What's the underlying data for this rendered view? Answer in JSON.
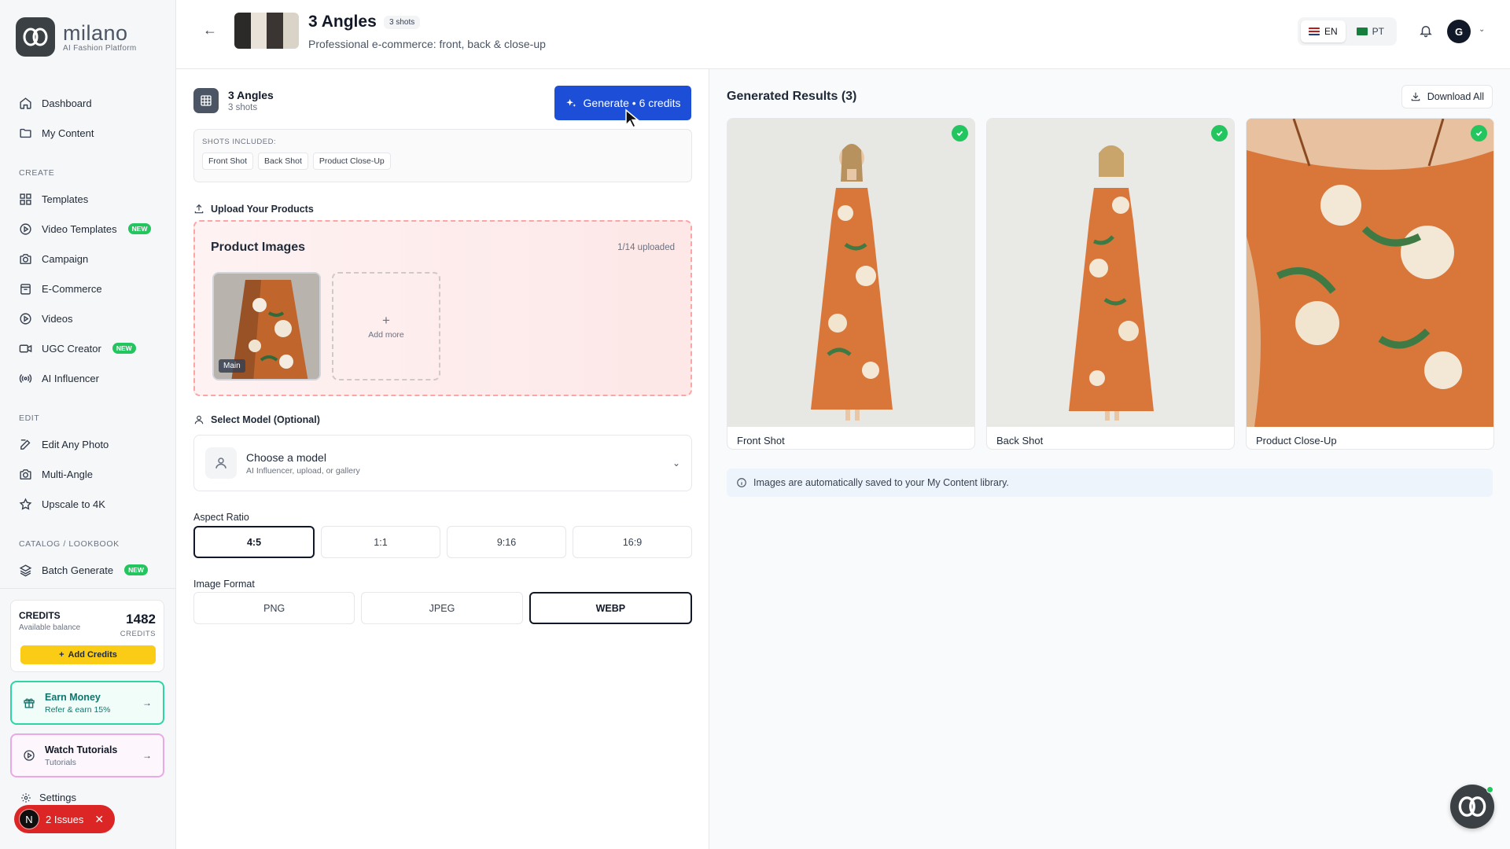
{
  "brand": {
    "name": "milano",
    "tagline": "AI Fashion Platform"
  },
  "nav": {
    "top": [
      {
        "label": "Dashboard",
        "icon": "home-icon"
      },
      {
        "label": "My Content",
        "icon": "folder-icon"
      }
    ],
    "create_label": "CREATE",
    "create": [
      {
        "label": "Templates",
        "icon": "grid-icon"
      },
      {
        "label": "Video Templates",
        "icon": "play-circle-icon",
        "badge": "NEW"
      },
      {
        "label": "Campaign",
        "icon": "camera-icon"
      },
      {
        "label": "E-Commerce",
        "icon": "shopping-bag-icon"
      },
      {
        "label": "Videos",
        "icon": "play-circle-icon"
      },
      {
        "label": "UGC Creator",
        "icon": "video-icon",
        "badge": "NEW"
      },
      {
        "label": "AI Influencer",
        "icon": "radio-icon"
      }
    ],
    "edit_label": "EDIT",
    "edit": [
      {
        "label": "Edit Any Photo",
        "icon": "edit-icon"
      },
      {
        "label": "Multi-Angle",
        "icon": "camera-icon"
      },
      {
        "label": "Upscale to 4K",
        "icon": "star-icon"
      }
    ],
    "catalog_label": "CATALOG / LOOKBOOK",
    "catalog": [
      {
        "label": "Batch Generate",
        "icon": "layers-icon",
        "badge": "NEW"
      }
    ]
  },
  "credits": {
    "title": "CREDITS",
    "subtitle": "Available balance",
    "amount": "1482",
    "unit": "CREDITS",
    "add_label": "Add Credits"
  },
  "earn": {
    "title": "Earn Money",
    "subtitle": "Refer & earn 15%"
  },
  "tutorials": {
    "title": "Watch Tutorials",
    "subtitle": "Tutorials"
  },
  "settings_label": "Settings",
  "issues": {
    "initial": "N",
    "label": "2 Issues"
  },
  "header": {
    "title": "3 Angles",
    "badge": "3 shots",
    "subtitle": "Professional e-commerce: front, back & close-up",
    "langs": [
      {
        "code": "EN",
        "active": true
      },
      {
        "code": "PT",
        "active": false
      }
    ],
    "avatar_initial": "G"
  },
  "template": {
    "title": "3 Angles",
    "subtitle": "3 shots",
    "generate_label": "Generate • 6 credits",
    "shots_label": "SHOTS INCLUDED:",
    "shots": [
      "Front Shot",
      "Back Shot",
      "Product Close-Up"
    ]
  },
  "upload": {
    "section_label": "Upload Your Products",
    "title": "Product Images",
    "count": "1/14 uploaded",
    "main_tag": "Main",
    "add_more": "Add more"
  },
  "model": {
    "section_label": "Select Model (Optional)",
    "title": "Choose a model",
    "subtitle": "AI Influencer, upload, or gallery"
  },
  "aspect": {
    "label": "Aspect Ratio",
    "options": [
      "4:5",
      "1:1",
      "9:16",
      "16:9"
    ],
    "selected": "4:5"
  },
  "format": {
    "label": "Image Format",
    "options": [
      "PNG",
      "JPEG",
      "WEBP"
    ],
    "selected": "WEBP"
  },
  "results": {
    "title": "Generated Results (3)",
    "download_label": "Download All",
    "cards": [
      {
        "label": "Front Shot"
      },
      {
        "label": "Back Shot"
      },
      {
        "label": "Product Close-Up"
      }
    ],
    "info": "Images are automatically saved to your My Content library."
  },
  "colors": {
    "accent": "#1d4ed8",
    "success": "#22c55e",
    "credits": "#facc15",
    "danger": "#dc2626",
    "dress": "#d9773a"
  }
}
